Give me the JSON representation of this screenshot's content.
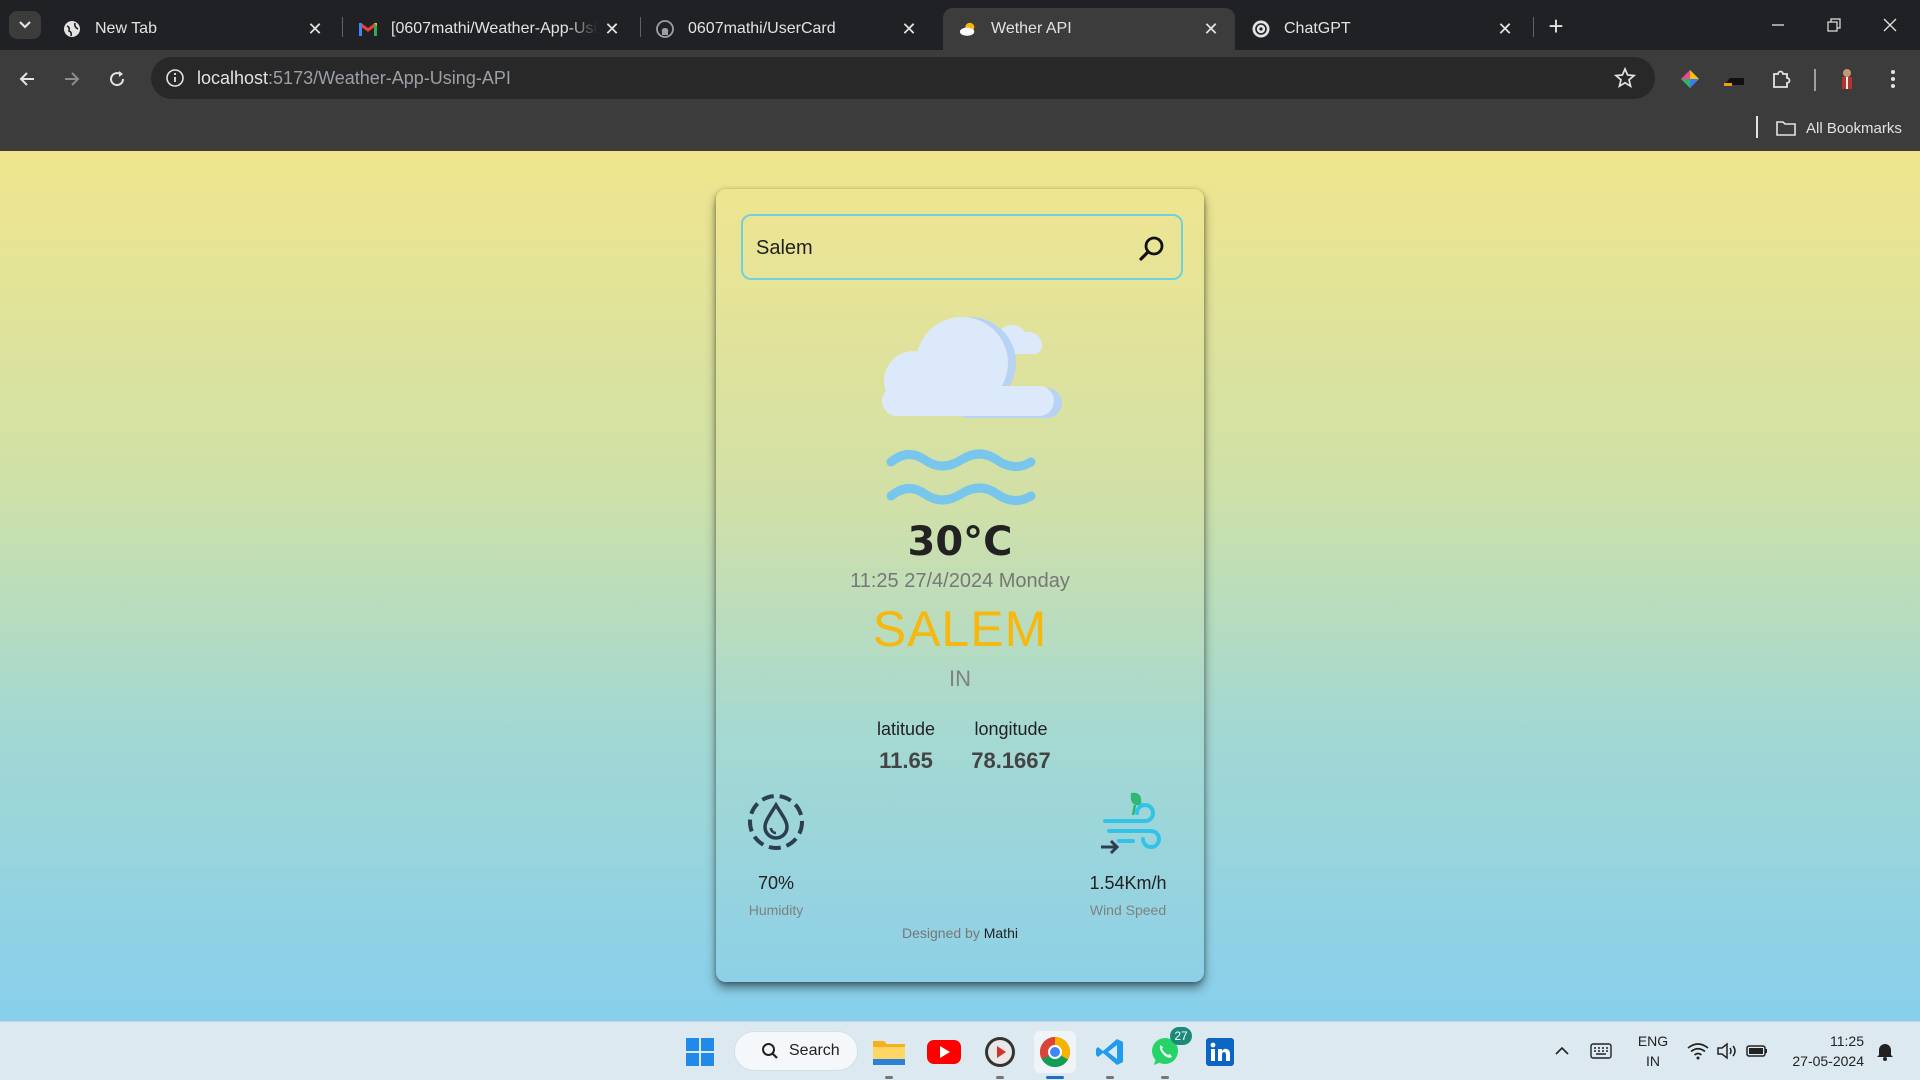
{
  "browser": {
    "tabs": [
      {
        "title": "New Tab",
        "icon": "globe-icon"
      },
      {
        "title": "[0607mathi/Weather-App-Using-API]",
        "icon": "gmail-icon"
      },
      {
        "title": "0607mathi/UserCard",
        "icon": "github-icon"
      },
      {
        "title": "Wether API",
        "icon": "weather-favicon",
        "active": true
      },
      {
        "title": "ChatGPT",
        "icon": "chatgpt-icon"
      }
    ],
    "url_host": "localhost",
    "url_rest": ":5173/Weather-App-Using-API",
    "bookmarks_label": "All Bookmarks"
  },
  "weather": {
    "search_value": "Salem",
    "temperature": "30°C",
    "datetime": "11:25 27/4/2024 Monday",
    "city": "SALEM",
    "country": "IN",
    "latitude_label": "latitude",
    "latitude": "11.65",
    "longitude_label": "longitude",
    "longitude": "78.1667",
    "humidity": "70%",
    "humidity_label": "Humidity",
    "wind": "1.54Km/h",
    "wind_label": "Wind Speed",
    "footer_prefix": "Designed by",
    "footer_author": "Mathi",
    "colors": {
      "city": "#f6b70f",
      "search_border": "#6fd1e0"
    }
  },
  "taskbar": {
    "search_label": "Search",
    "whatsapp_badge": "27",
    "lang_line1": "ENG",
    "lang_line2": "IN",
    "time": "11:25",
    "date": "27-05-2024"
  }
}
